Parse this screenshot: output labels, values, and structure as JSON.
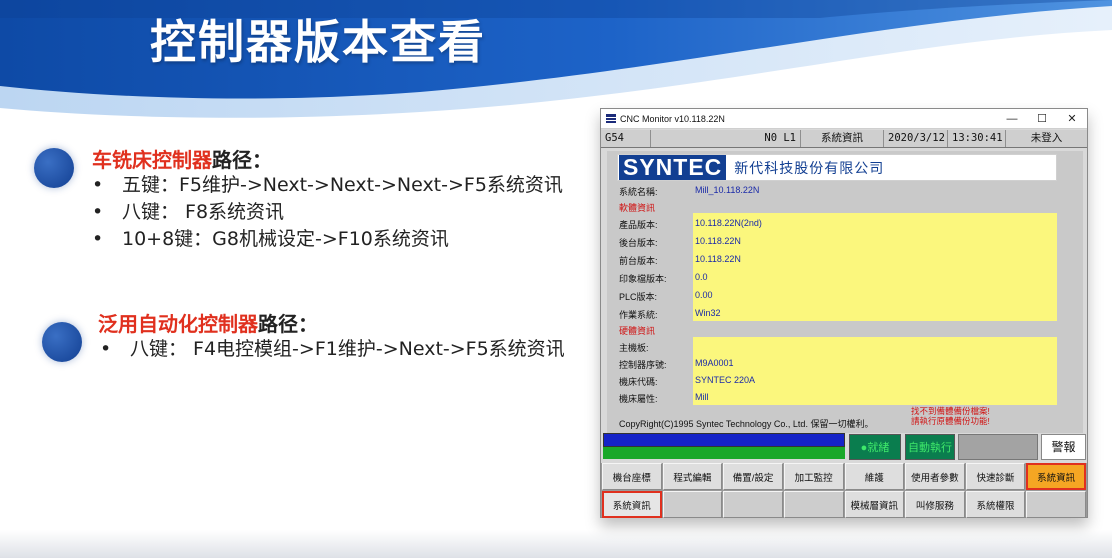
{
  "slide": {
    "title": "控制器版本查看",
    "section1": {
      "heading_red": "车铣床控制器",
      "heading_rest": "路径：",
      "bullets": [
        "五键：F5维护->Next->Next->Next->F5系统资讯",
        "八键：  F8系统资讯",
        "10+8键：G8机械设定->F10系统资讯"
      ]
    },
    "section2": {
      "heading_red": "泛用自动化控制器",
      "heading_rest": "路径：",
      "bullets": [
        "八键：  F4电控模组->F1维护->Next->F5系统资讯"
      ]
    }
  },
  "window": {
    "title": "CNC Monitor v10.118.22N",
    "controls": {
      "minimize": "—",
      "maximize": "☐",
      "close": "✕"
    },
    "status": {
      "coord": "G54",
      "channel": "N0 L1",
      "mode": "系統資訊",
      "date": "2020/3/12",
      "time": "13:30:41",
      "login": "未登入"
    },
    "logo": {
      "brand": "SYNTEC",
      "company": "新代科技股份有限公司"
    },
    "system_name": {
      "label": "系統名稱:",
      "value": "Mill_10.118.22N"
    },
    "software_section": "軟體資訊",
    "software": [
      {
        "label": "產品版本:",
        "value": "10.118.22N(2nd)"
      },
      {
        "label": "後台版本:",
        "value": "10.118.22N"
      },
      {
        "label": "前台版本:",
        "value": "10.118.22N"
      },
      {
        "label": "印象檔版本:",
        "value": "0.0"
      },
      {
        "label": "PLC版本:",
        "value": "0.00"
      },
      {
        "label": "作業系統:",
        "value": "Win32"
      }
    ],
    "hardware_section": "硬體資訊",
    "hardware": [
      {
        "label": "主機板:",
        "value": ""
      },
      {
        "label": "控制器序號:",
        "value": "M9A0001"
      },
      {
        "label": "機床代碼:",
        "value": "SYNTEC 220A"
      },
      {
        "label": "機床屬性:",
        "value": "Mill"
      }
    ],
    "copyright": "CopyRight(C)1995 Syntec Technology Co., Ltd. 保留一切權利。",
    "warning_line1": "找不到備體備份檔案!",
    "warning_line2": "請執行原體備份功能!",
    "cycle_start": "●就緒",
    "auto_mode": "自動執行",
    "alarm": "警報",
    "softkeys_row1": [
      "機台座標",
      "程式編輯",
      "備置/設定",
      "加工監控",
      "維護",
      "使用者參數",
      "快速診斷",
      "系統資訊"
    ],
    "softkeys_row2": [
      "系統資訊",
      "",
      "",
      "",
      "模械層資訊",
      "叫修服務",
      "系統權限",
      ""
    ]
  }
}
